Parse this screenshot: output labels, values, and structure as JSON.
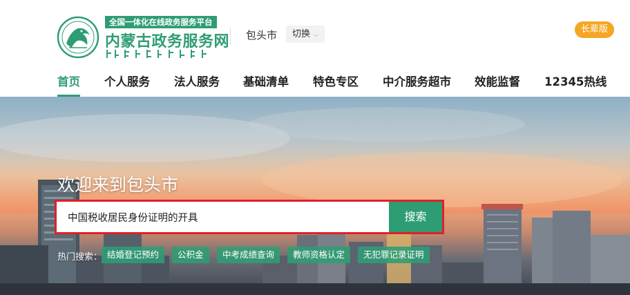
{
  "header": {
    "platform_tag": "全国一体化在线政务服务平台",
    "site_title": "内蒙古政务服务网",
    "city": "包头市",
    "switch_label": "切换",
    "elder_mode_label": "长辈版"
  },
  "nav": {
    "items": [
      {
        "label": "首页",
        "active": true
      },
      {
        "label": "个人服务",
        "active": false
      },
      {
        "label": "法人服务",
        "active": false
      },
      {
        "label": "基础清单",
        "active": false
      },
      {
        "label": "特色专区",
        "active": false
      },
      {
        "label": "中介服务超市",
        "active": false
      },
      {
        "label": "效能监督",
        "active": false
      },
      {
        "label": "12345热线",
        "active": false
      }
    ]
  },
  "banner": {
    "welcome": "欢迎来到包头市"
  },
  "search": {
    "value": "中国税收居民身份证明的开具",
    "button_label": "搜索"
  },
  "hot_search": {
    "label": "热门搜索：",
    "tags": [
      "结婚登记预约",
      "公积金",
      "中考成绩查询",
      "教师资格认定",
      "无犯罪记录证明"
    ]
  },
  "colors": {
    "brand_green": "#2f9d74",
    "elder_orange": "#f5a623",
    "search_highlight_red": "#e0202a"
  },
  "icons": {
    "logo": "inner-mongolia-emblem-icon",
    "chevron": "chevron-down-icon"
  }
}
